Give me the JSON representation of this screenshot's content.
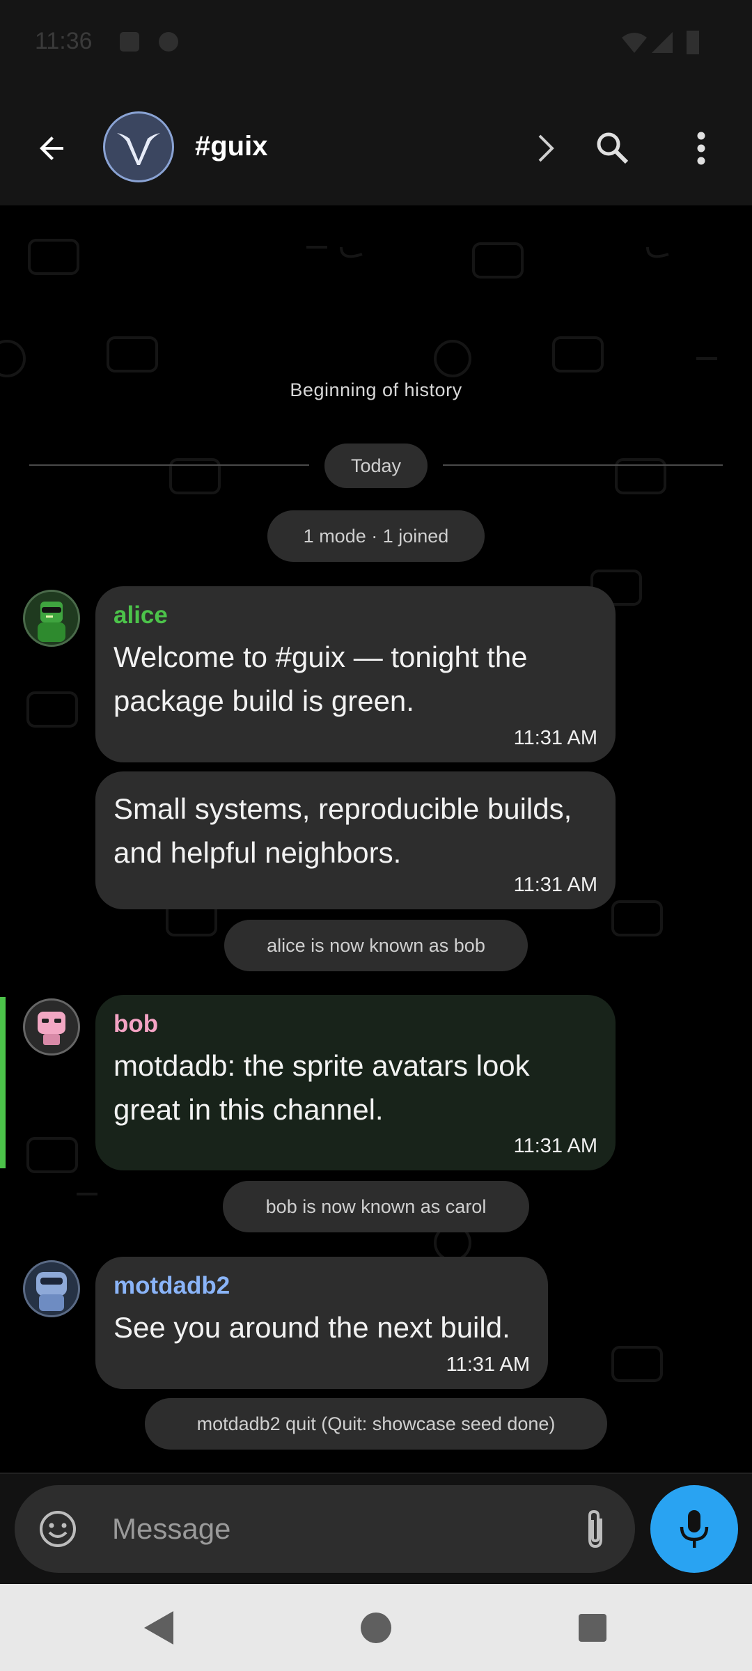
{
  "status_bar": {
    "time": "11:36"
  },
  "toolbar": {
    "title": "#guix"
  },
  "chat": {
    "history_label": "Beginning of history",
    "date_label": "Today",
    "events": {
      "summary": "1 mode · 1 joined",
      "nick_change_1": "alice is now known as bob",
      "nick_change_2": "bob is now known as carol",
      "quit": "motdadb2 quit (Quit: showcase seed done)"
    },
    "messages": [
      {
        "author": "alice",
        "author_color": "#4cc34a",
        "text": "Welcome to #guix — tonight the package build is green.",
        "time": "11:31 AM"
      },
      {
        "author": "",
        "text": "Small systems, reproducible builds, and helpful neighbors.",
        "time": "11:31 AM"
      },
      {
        "author": "bob",
        "author_color": "#f4a3c4",
        "text": "motdadb: the sprite avatars look great in this channel.",
        "time": "11:31 AM",
        "highlighted": true
      },
      {
        "author": "motdadb2",
        "author_color": "#8ab4f8",
        "text": "See you around the next build.",
        "time": "11:31 AM"
      }
    ]
  },
  "composer": {
    "placeholder": "Message"
  },
  "colors": {
    "accent": "#29a3f2",
    "highlight": "#4cc34a",
    "bubble": "#2d2d2d",
    "bubble_highlight": "#18231a"
  }
}
